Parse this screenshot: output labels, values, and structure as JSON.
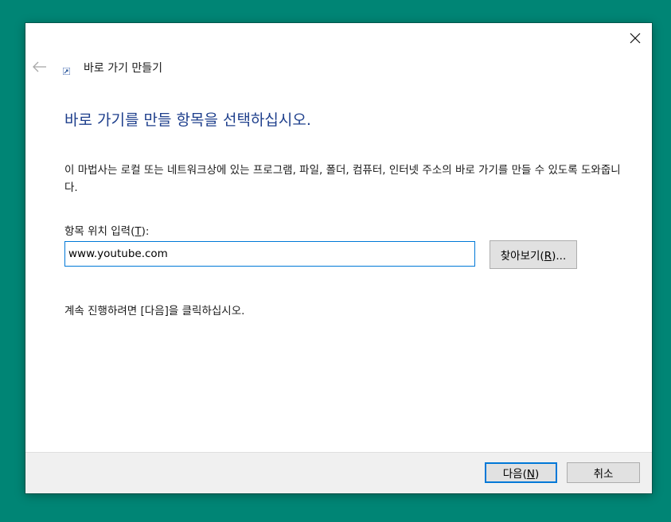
{
  "wizard": {
    "title": "바로 가기 만들기",
    "back_icon": "back-arrow-icon",
    "app_icon": "shortcut-icon",
    "close_icon": "close-icon"
  },
  "main": {
    "heading": "바로 가기를 만들 항목을 선택하십시오.",
    "description": "이 마법사는 로컬 또는 네트워크상에 있는 프로그램, 파일, 폴더, 컴퓨터, 인터넷 주소의 바로 가기를 만들 수 있도록 도와줍니다.",
    "location_label_prefix": "항목 위치 입력(",
    "location_label_key": "T",
    "location_label_suffix": "):",
    "location_value": "www.youtube.com",
    "browse_prefix": "찾아보기(",
    "browse_key": "R",
    "browse_suffix": ")...",
    "instruction": "계속 진행하려면 [다음]을 클릭하십시오."
  },
  "footer": {
    "next_prefix": "다음(",
    "next_key": "N",
    "next_suffix": ")",
    "cancel_label": "취소"
  },
  "colors": {
    "desktop": "#008575",
    "heading": "#1e3f8c",
    "focus_border": "#0078d7",
    "footer_bg": "#f0f0f0",
    "button_bg": "#e1e1e1"
  }
}
